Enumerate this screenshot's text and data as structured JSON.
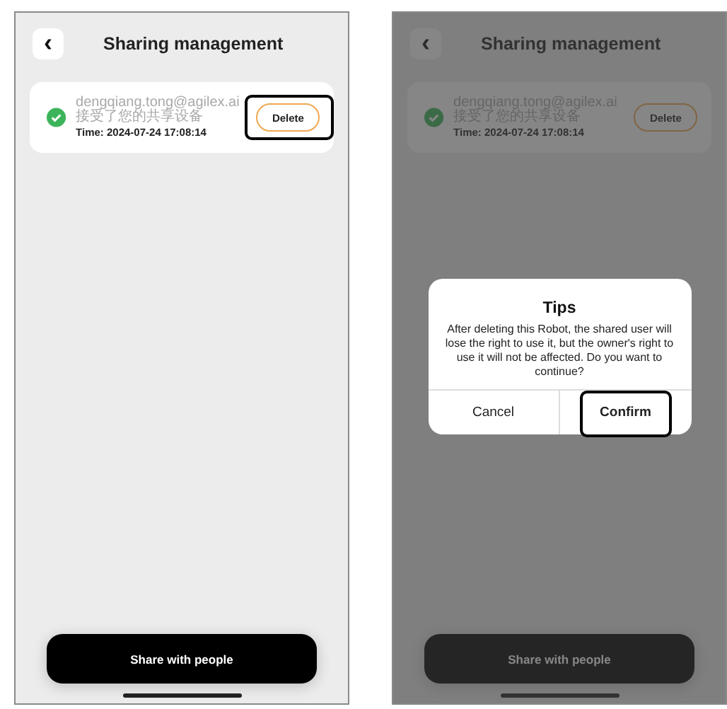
{
  "screens": [
    {
      "title": "Sharing management",
      "back": "‹",
      "share": {
        "email": "dengqiang.tong@agilex.ai接受了您的共享设备",
        "time": "Time: 2024-07-24 17:08:14",
        "checked": true,
        "delete": "Delete",
        "delete_highlighted": true
      },
      "share_button": "Share with people"
    },
    {
      "title": "Sharing management",
      "back": "‹",
      "share": {
        "email": "dengqiang.tong@agilex.ai接受了您的共享设备",
        "time": "Time: 2024-07-24 17:08:14",
        "checked": true,
        "delete": "Delete",
        "delete_highlighted": false
      },
      "share_button": "Share with people",
      "dialog": {
        "title": "Tips",
        "message": "After deleting this Robot, the shared user will lose the right to use it, but the owner's right to use it will not be affected. Do you want to continue?",
        "buttons": [
          {
            "label": "Cancel",
            "highlighted": false
          },
          {
            "label": "Confirm",
            "highlighted": true
          }
        ]
      }
    }
  ]
}
